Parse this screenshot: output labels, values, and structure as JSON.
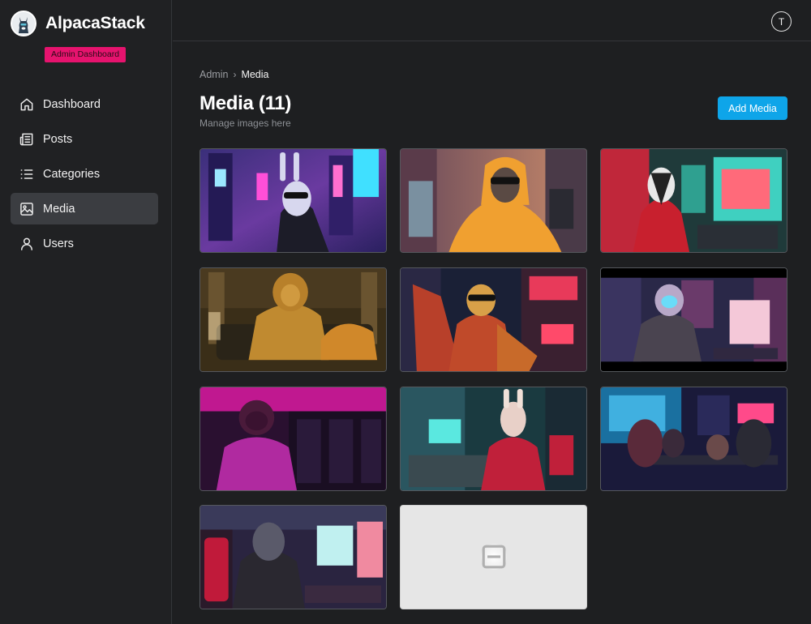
{
  "app": {
    "name": "AlpacaStack",
    "badge": "Admin Dashboard"
  },
  "sidebar": {
    "items": [
      {
        "label": "Dashboard",
        "icon": "home-icon",
        "active": false
      },
      {
        "label": "Posts",
        "icon": "newspaper-icon",
        "active": false
      },
      {
        "label": "Categories",
        "icon": "list-icon",
        "active": false
      },
      {
        "label": "Media",
        "icon": "image-icon",
        "active": true
      },
      {
        "label": "Users",
        "icon": "user-icon",
        "active": false
      }
    ]
  },
  "header": {
    "avatar_initial": "T"
  },
  "breadcrumb": {
    "root": "Admin",
    "current": "Media"
  },
  "page": {
    "title": "Media (11)",
    "subtitle": "Manage images here",
    "add_button": "Add Media"
  },
  "colors": {
    "accent": "#0ea5e9",
    "badge": "#e6136e",
    "background": "#1e1f21"
  }
}
